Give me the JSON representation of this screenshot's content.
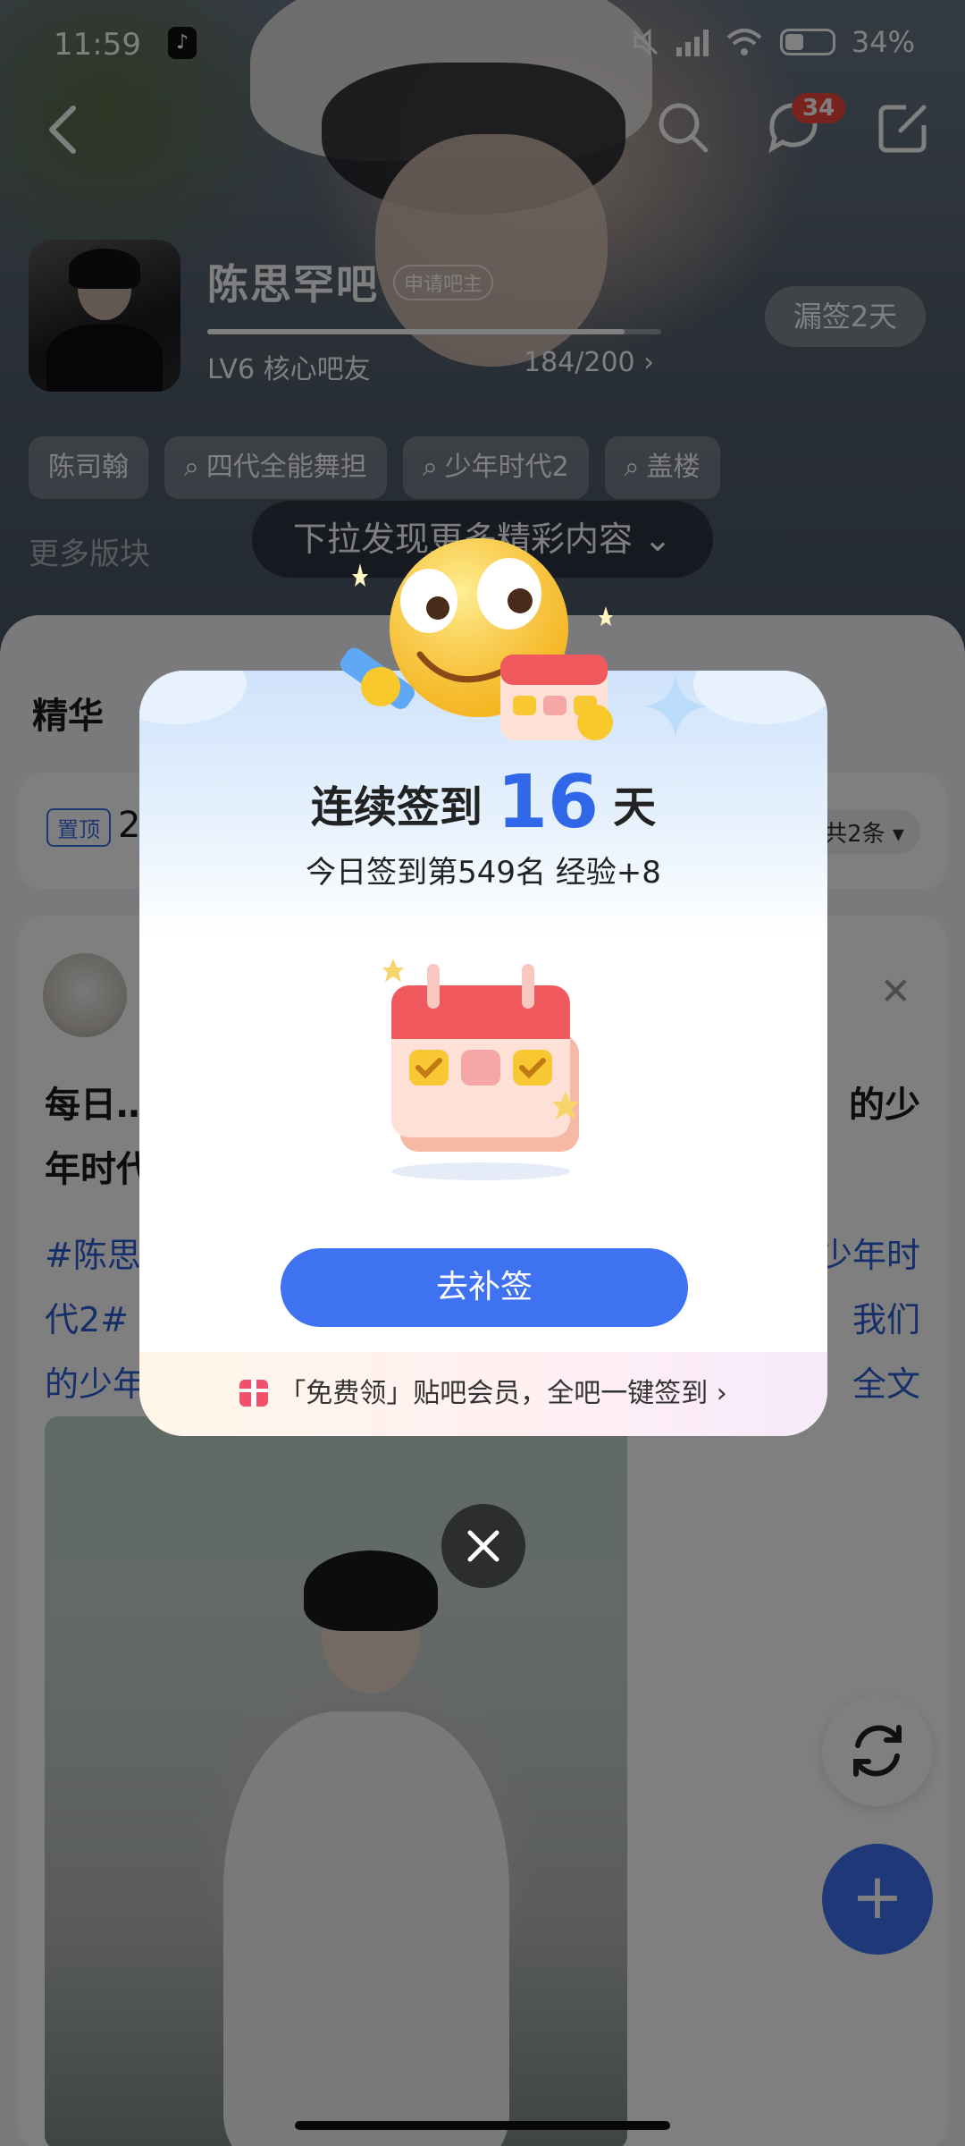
{
  "status_bar": {
    "time": "11:59",
    "battery": "34%"
  },
  "nav": {
    "message_count": "34"
  },
  "forum": {
    "name": "陈思罕吧",
    "apply_label": "申请吧主",
    "level": "LV6 核心吧友",
    "exp": "184/200",
    "exp_progress": 0.92,
    "missed_label": "漏签2天"
  },
  "chips": [
    {
      "label": "陈司翰",
      "icon": null
    },
    {
      "label": "四代全能舞担",
      "icon": "search-icon"
    },
    {
      "label": "少年时代2",
      "icon": "search-icon"
    },
    {
      "label": "盖楼",
      "icon": "search-icon"
    }
  ],
  "more_sections": "更多版块",
  "pull_hint": "下拉发现更多精彩内容",
  "sheet": {
    "tab": "精华",
    "pinned_tag": "置顶",
    "pinned_title": "2",
    "pinned_sort": "共2条",
    "post_title_left": "每日…",
    "post_title_right": "的少",
    "post_title_line2": "年时代",
    "post_body_line1_left": "#陈思",
    "post_body_line1_right": "少年时",
    "post_body_line2_left": "代2#",
    "post_body_line2_right": "我们",
    "post_body_line3_left": "的少年",
    "post_body_line3_right": "全文"
  },
  "dialog": {
    "streak_prefix": "连续签到",
    "streak_days": "16",
    "streak_suffix": "天",
    "rank_text": "今日签到第549名 经验+8",
    "resign_label": "去补签",
    "footer_text": "「免费领」贴吧会员，全吧一键签到 ›"
  },
  "colors": {
    "accent_blue": "#3f72f0",
    "badge_red": "#f0463c"
  }
}
